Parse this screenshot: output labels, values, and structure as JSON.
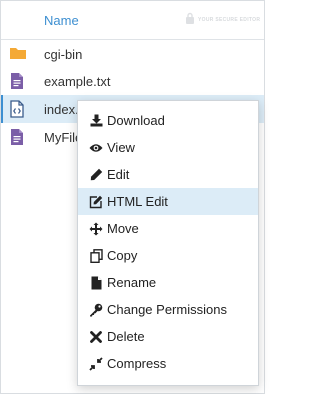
{
  "header": {
    "name_label": "Name",
    "watermark_text": "YOUR SECURE EDITOR"
  },
  "files": [
    {
      "name": "cgi-bin",
      "icon": "folder-icon",
      "color": "#f4a935"
    },
    {
      "name": "example.txt",
      "icon": "text-file-icon",
      "color": "#7b5ea7"
    },
    {
      "name": "index.",
      "icon": "code-file-icon",
      "color": "#3b5c8c"
    },
    {
      "name": "MyFile",
      "icon": "text-file-icon",
      "color": "#7b5ea7"
    }
  ],
  "context_menu": {
    "items": [
      {
        "label": "Download",
        "icon": "download-icon"
      },
      {
        "label": "View",
        "icon": "eye-icon"
      },
      {
        "label": "Edit",
        "icon": "pencil-icon"
      },
      {
        "label": "HTML Edit",
        "icon": "edit-square-icon"
      },
      {
        "label": "Move",
        "icon": "move-arrows-icon"
      },
      {
        "label": "Copy",
        "icon": "copy-icon"
      },
      {
        "label": "Rename",
        "icon": "file-icon"
      },
      {
        "label": "Change Permissions",
        "icon": "key-icon"
      },
      {
        "label": "Delete",
        "icon": "x-icon"
      },
      {
        "label": "Compress",
        "icon": "compress-icon"
      }
    ],
    "highlighted": "HTML Edit"
  },
  "colors": {
    "accent": "#3d8fd1",
    "selection": "#dcecf7"
  }
}
